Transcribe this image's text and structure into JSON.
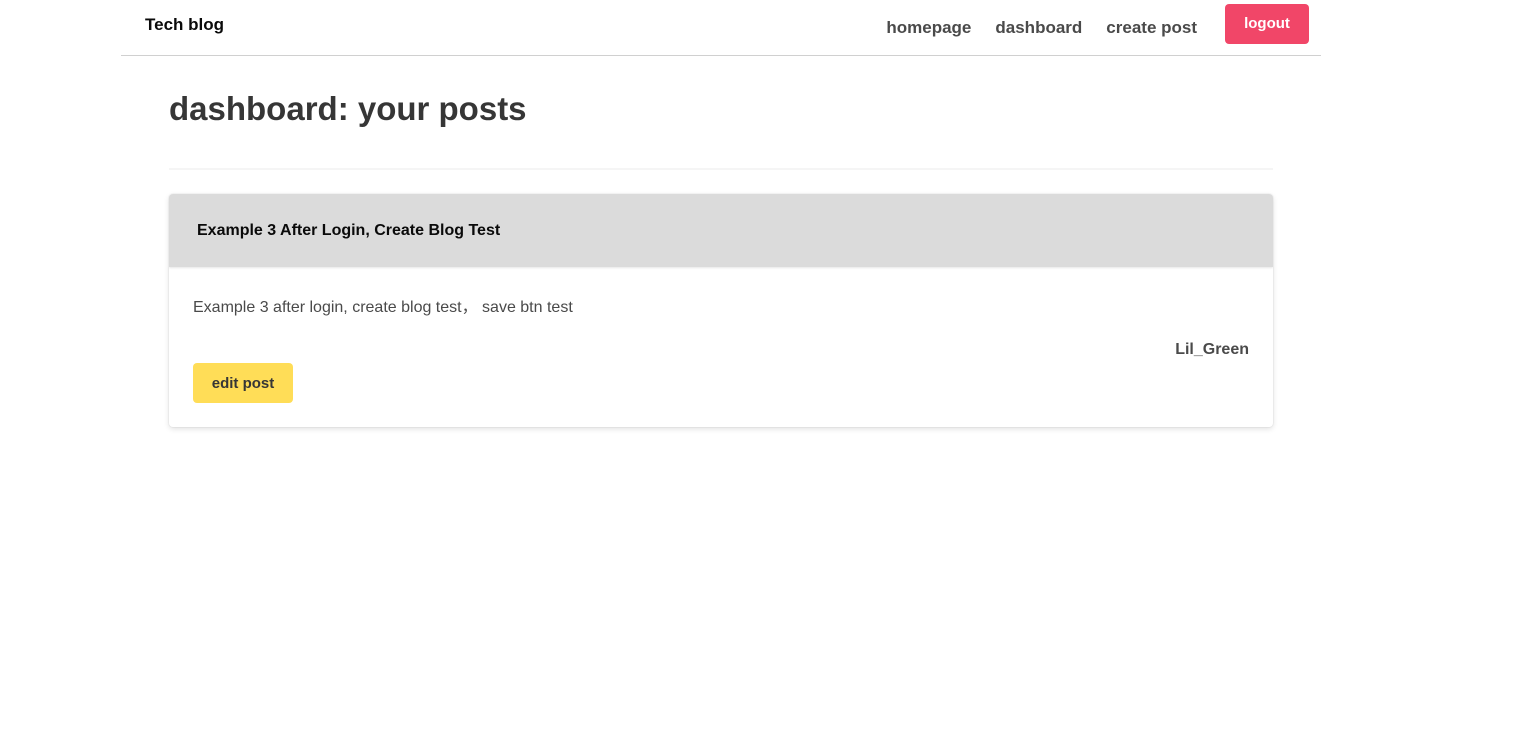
{
  "navbar": {
    "brand": "Tech blog",
    "links": [
      {
        "label": "homepage"
      },
      {
        "label": "dashboard"
      },
      {
        "label": "create post"
      }
    ],
    "logout_label": "logout"
  },
  "page": {
    "title": "dashboard: your posts"
  },
  "posts": [
    {
      "title": "Example 3 After Login, Create Blog Test",
      "content": "Example 3 after login, create blog test， save btn test",
      "author": "Lil_Green",
      "edit_label": "edit post"
    }
  ],
  "colors": {
    "logout_button": "#f14668",
    "edit_button": "#ffdd57",
    "card_header": "#dbdbdb"
  }
}
